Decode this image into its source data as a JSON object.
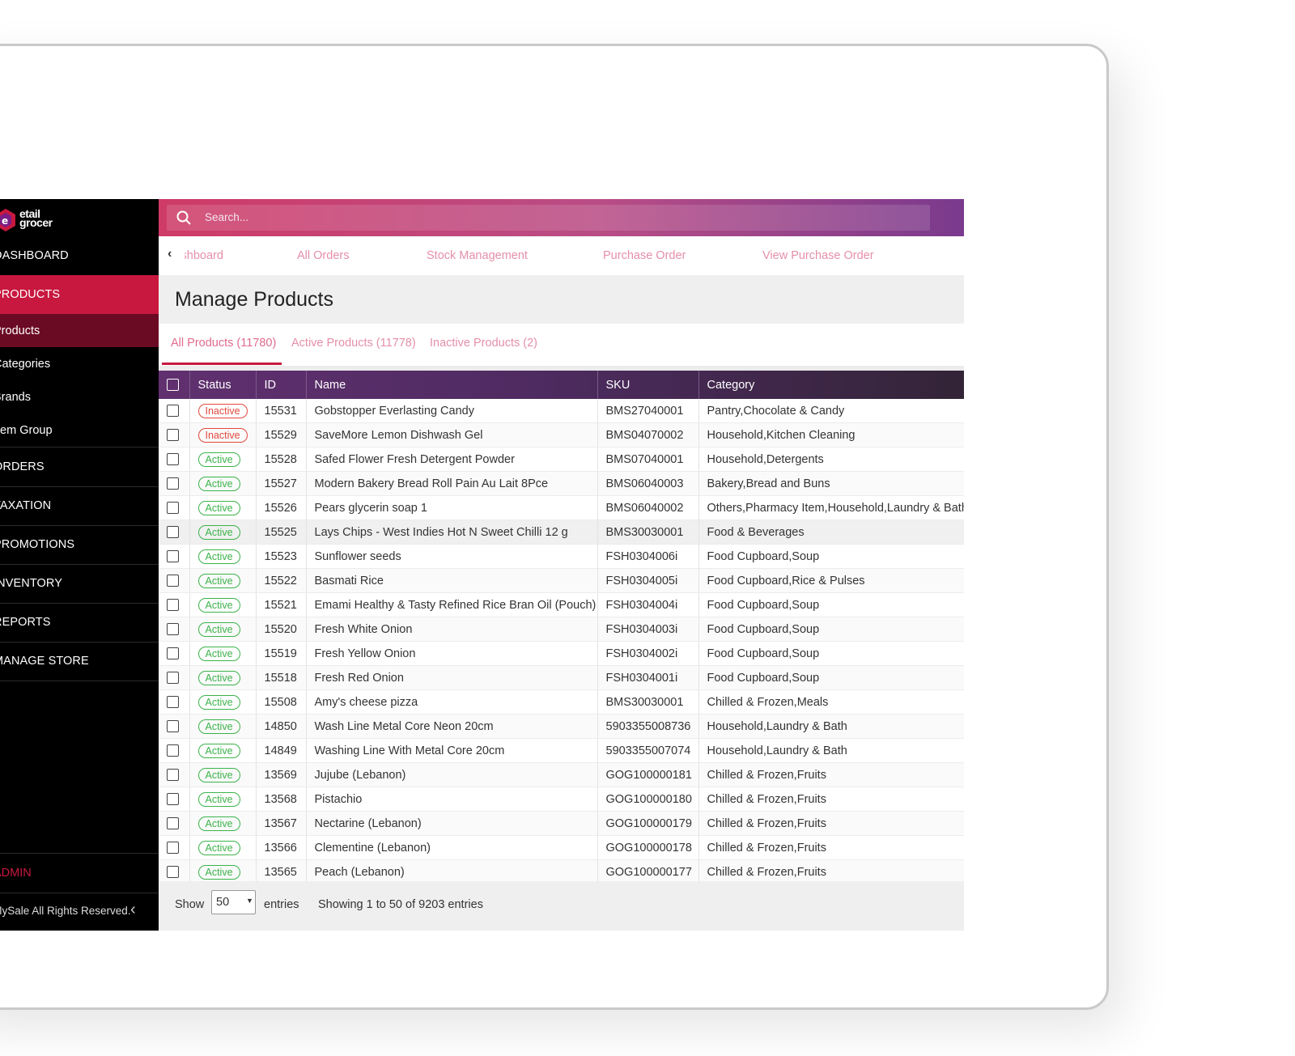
{
  "colors": {
    "accent": "#c8183f",
    "sidebar_bg": "#000000",
    "active_green": "#3bb34a",
    "inactive_red": "#e2493f"
  },
  "brand": {
    "logo_line1": "etail",
    "logo_line2": "grocer"
  },
  "sidebar": {
    "items": [
      {
        "label": "DASHBOARD",
        "icon": "dashboard-icon"
      },
      {
        "label": "PRODUCTS",
        "icon": "cube-icon",
        "active": true
      },
      {
        "label": "ORDERS",
        "icon": "cart-icon"
      },
      {
        "label": "TAXATION",
        "icon": "taxation-icon"
      },
      {
        "label": "PROMOTIONS",
        "icon": "box-icon"
      },
      {
        "label": "INVENTORY",
        "icon": "folder-icon"
      },
      {
        "label": "REPORTS",
        "icon": "chart-icon"
      },
      {
        "label": "MANAGE STORE",
        "icon": "store-icon"
      }
    ],
    "subitems": [
      "Products",
      "Categories",
      "Brands",
      "Item Group"
    ],
    "admin_label": "ADMIN",
    "copyright": "© BoostMySale All Rights Reserved."
  },
  "search": {
    "placeholder": "Search..."
  },
  "top_tabs": [
    "Dashboard",
    "All Orders",
    "Stock Management",
    "Purchase Order",
    "View Purchase Order"
  ],
  "page_title": "Manage Products",
  "filter_tabs": [
    "All Products (11780)",
    "Active Products (11778)",
    "Inactive Products (2)"
  ],
  "table": {
    "columns": [
      "Status",
      "ID",
      "Name",
      "SKU",
      "Category"
    ],
    "rows": [
      {
        "status": "Inactive",
        "id": "15531",
        "name": "Gobstopper Everlasting Candy",
        "sku": "BMS27040001",
        "category": "Pantry,Chocolate & Candy"
      },
      {
        "status": "Inactive",
        "id": "15529",
        "name": "SaveMore Lemon Dishwash Gel",
        "sku": "BMS04070002",
        "category": "Household,Kitchen Cleaning"
      },
      {
        "status": "Active",
        "id": "15528",
        "name": "Safed Flower Fresh Detergent Powder",
        "sku": "BMS07040001",
        "category": "Household,Detergents"
      },
      {
        "status": "Active",
        "id": "15527",
        "name": "Modern Bakery Bread Roll Pain Au Lait 8Pce",
        "sku": "BMS06040003",
        "category": "Bakery,Bread and Buns"
      },
      {
        "status": "Active",
        "id": "15526",
        "name": "Pears glycerin soap 1",
        "sku": "BMS06040002",
        "category": "Others,Pharmacy Item,Household,Laundry & Bath"
      },
      {
        "status": "Active",
        "id": "15525",
        "name": "Lays Chips - West Indies Hot N Sweet Chilli 12 g",
        "sku": "BMS30030001",
        "category": "Food & Beverages"
      },
      {
        "status": "Active",
        "id": "15523",
        "name": "Sunflower seeds",
        "sku": "FSH0304006i",
        "category": "Food Cupboard,Soup"
      },
      {
        "status": "Active",
        "id": "15522",
        "name": "Basmati Rice",
        "sku": "FSH0304005i",
        "category": "Food Cupboard,Rice & Pulses"
      },
      {
        "status": "Active",
        "id": "15521",
        "name": "Emami Healthy & Tasty Refined Rice Bran Oil (Pouch)",
        "sku": "FSH0304004i",
        "category": "Food Cupboard,Soup"
      },
      {
        "status": "Active",
        "id": "15520",
        "name": "Fresh White Onion",
        "sku": "FSH0304003i",
        "category": "Food Cupboard,Soup"
      },
      {
        "status": "Active",
        "id": "15519",
        "name": "Fresh Yellow Onion",
        "sku": "FSH0304002i",
        "category": "Food Cupboard,Soup"
      },
      {
        "status": "Active",
        "id": "15518",
        "name": "Fresh Red Onion",
        "sku": "FSH0304001i",
        "category": "Food Cupboard,Soup"
      },
      {
        "status": "Active",
        "id": "15508",
        "name": "Amy's cheese pizza",
        "sku": "BMS30030001",
        "category": "Chilled & Frozen,Meals"
      },
      {
        "status": "Active",
        "id": "14850",
        "name": "Wash Line Metal Core Neon 20cm",
        "sku": "5903355008736",
        "category": "Household,Laundry & Bath"
      },
      {
        "status": "Active",
        "id": "14849",
        "name": "Washing Line With Metal Core 20cm",
        "sku": "5903355007074",
        "category": "Household,Laundry & Bath"
      },
      {
        "status": "Active",
        "id": "13569",
        "name": "Jujube (Lebanon)",
        "sku": "GOG100000181",
        "category": "Chilled & Frozen,Fruits"
      },
      {
        "status": "Active",
        "id": "13568",
        "name": "Pistachio",
        "sku": "GOG100000180",
        "category": "Chilled & Frozen,Fruits"
      },
      {
        "status": "Active",
        "id": "13567",
        "name": "Nectarine (Lebanon)",
        "sku": "GOG100000179",
        "category": "Chilled & Frozen,Fruits"
      },
      {
        "status": "Active",
        "id": "13566",
        "name": "Clementine (Lebanon)",
        "sku": "GOG100000178",
        "category": "Chilled & Frozen,Fruits"
      },
      {
        "status": "Active",
        "id": "13565",
        "name": "Peach (Lebanon)",
        "sku": "GOG100000177",
        "category": "Chilled & Frozen,Fruits"
      }
    ]
  },
  "pagination": {
    "show_label": "Show",
    "page_size": "50",
    "entries_label": "entries",
    "info": "Showing 1 to 50 of 9203 entries"
  }
}
